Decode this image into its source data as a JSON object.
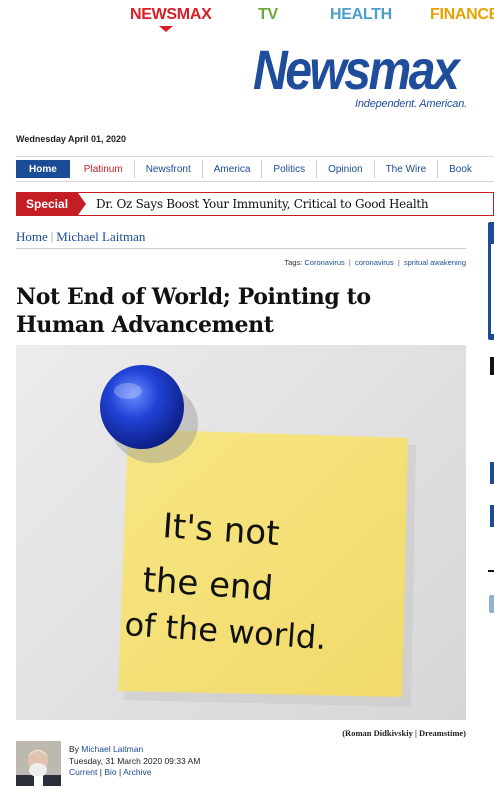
{
  "brand_nav": {
    "newsmax": "NEWSMAX",
    "tv": "TV",
    "health": "HEALTH",
    "finance": "FINANCE"
  },
  "logo": {
    "wordmark": "Newsmax",
    "tagline": "Independent. American."
  },
  "date": "Wednesday April 01, 2020",
  "menu": {
    "items": [
      "Home",
      "Platinum",
      "Newsfront",
      "America",
      "Politics",
      "Opinion",
      "The Wire",
      "Book"
    ]
  },
  "special": {
    "label": "Special",
    "headline": "Dr. Oz Says Boost Your Immunity, Critical to Good Health"
  },
  "breadcrumb": {
    "home": "Home",
    "separator": "|",
    "section": "Michael Laitman"
  },
  "tags": {
    "label": "Tags:",
    "items": [
      "Coronavirus",
      "coronavirus",
      "spritual awakening"
    ],
    "separator": "|"
  },
  "article": {
    "title": "Not End of World; Pointing to Human Advancement",
    "note_lines": [
      "It's not",
      "the end",
      "of the world."
    ],
    "photo_credit": "(Roman Didkivskiy | Dreamstime)"
  },
  "byline": {
    "by_label": "By",
    "author": "Michael Laitman",
    "datetime": "Tuesday, 31 March 2020 09:33 AM",
    "current": "Current",
    "bio": "Bio",
    "archive": "Archive",
    "sep": "|"
  },
  "colors": {
    "brand_blue": "#1b4c96",
    "brand_red": "#c41e24",
    "note_yellow": "#f6e27a",
    "magnet_blue": "#1f3fc4"
  }
}
